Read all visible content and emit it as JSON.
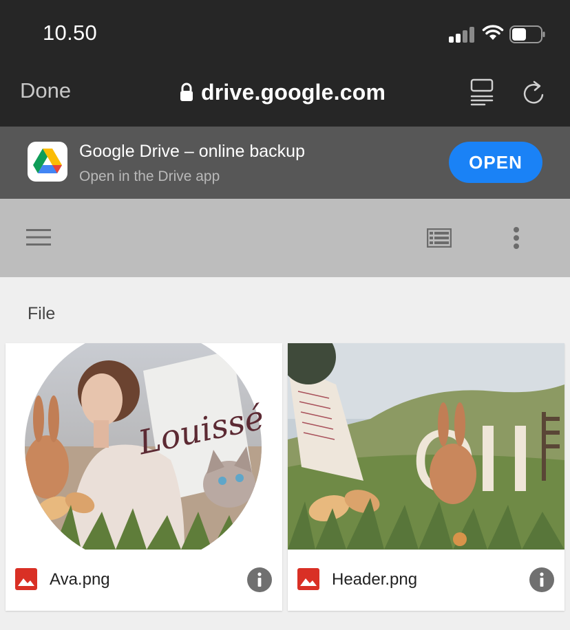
{
  "status_bar": {
    "time": "10.50"
  },
  "browser": {
    "done_label": "Done",
    "url": "drive.google.com"
  },
  "app_banner": {
    "title": "Google Drive – online backup",
    "subtitle": "Open in the Drive app",
    "open_label": "OPEN"
  },
  "section": {
    "label": "File"
  },
  "files": [
    {
      "name": "Ava.png",
      "thumb_text": "Louissé"
    },
    {
      "name": "Header.png"
    }
  ],
  "colors": {
    "chrome": "#262626",
    "banner": "#575757",
    "toolbar": "#bdbdbd",
    "open_button": "#1a82f6",
    "image_icon": "#d93025"
  }
}
